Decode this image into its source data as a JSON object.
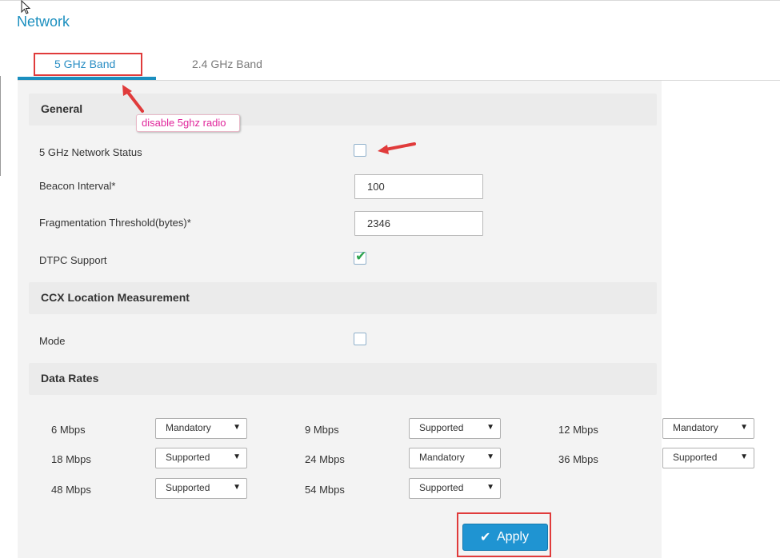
{
  "page": {
    "title": "Network"
  },
  "tabs": [
    {
      "label": "5 GHz Band",
      "active": true
    },
    {
      "label": "2.4 GHz Band",
      "active": false
    }
  ],
  "sections": {
    "general": "General",
    "ccx": "CCX Location Measurement",
    "data_rates": "Data Rates"
  },
  "general": {
    "network_status": {
      "label": "5 GHz Network Status",
      "checked": false
    },
    "beacon_interval": {
      "label": "Beacon Interval*",
      "value": "100"
    },
    "fragmentation_threshold": {
      "label": "Fragmentation Threshold(bytes)*",
      "value": "2346"
    },
    "dtpc_support": {
      "label": "DTPC Support",
      "checked": true
    }
  },
  "ccx": {
    "mode": {
      "label": "Mode",
      "checked": false
    }
  },
  "data_rates": {
    "rows": [
      [
        {
          "rate": "6 Mbps",
          "value": "Mandatory"
        },
        {
          "rate": "9 Mbps",
          "value": "Supported"
        },
        {
          "rate": "12 Mbps",
          "value": "Mandatory"
        }
      ],
      [
        {
          "rate": "18 Mbps",
          "value": "Supported"
        },
        {
          "rate": "24 Mbps",
          "value": "Mandatory"
        },
        {
          "rate": "36 Mbps",
          "value": "Supported"
        }
      ],
      [
        {
          "rate": "48 Mbps",
          "value": "Supported"
        },
        {
          "rate": "54 Mbps",
          "value": "Supported"
        }
      ]
    ]
  },
  "apply_button": {
    "label": "Apply",
    "icon": "check-icon"
  },
  "annotation": {
    "text": "disable 5ghz radio"
  },
  "colors": {
    "accent": "#1b8fbf",
    "button": "#1f94d2",
    "annotation_red": "#e03b3b",
    "annotation_text": "#e0269b",
    "checkmark": "#2da44e"
  }
}
